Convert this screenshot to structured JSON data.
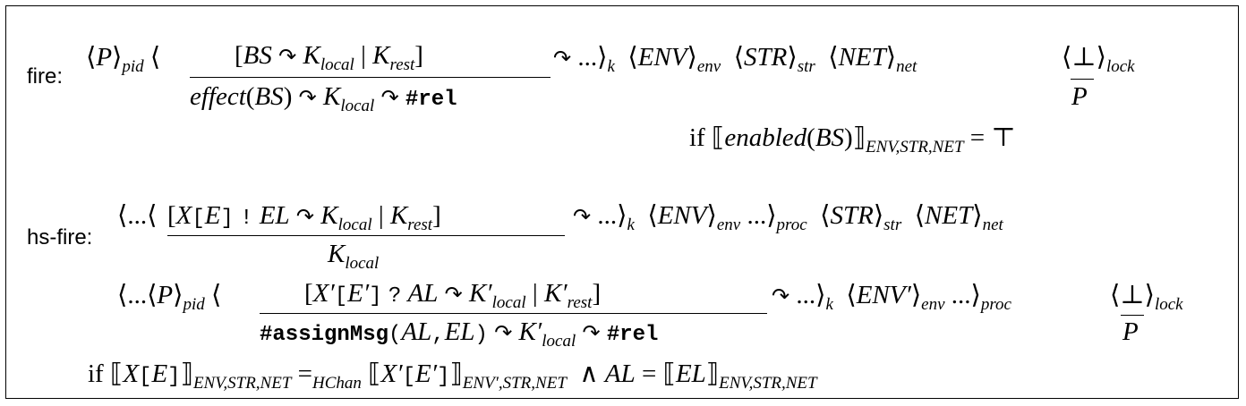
{
  "rules": [
    {
      "label": "fire:",
      "lines": [
        "⟨P⟩pid ⟨ [BS ↷ Klocal | Krest] / effect(BS) ↷ Klocal ↷ #rel ↷ ...⟩k ⟨ENV⟩env ⟨STR⟩str ⟨NET⟩net ⟨⊥ / P⟩lock",
        "if ⟦enabled(BS)⟧ENV,STR,NET = ⊤"
      ]
    },
    {
      "label": "hs-fire:",
      "lines": [
        "⟨...⟨[X[E] ! EL ↷ Klocal | Krest] / Klocal ↷ ...⟩k ⟨ENV⟩env ...⟩proc ⟨STR⟩str ⟨NET⟩net",
        "⟨...⟨P⟩pid ⟨ [X′[E′] ? AL ↷ K′local | K′rest] / #assignMsg(AL,EL) ↷ K′local ↷ #rel ↷ ...⟩k ⟨ENV′⟩env ...⟩proc ⟨⊥ / P⟩lock",
        "if ⟦X[E]⟧ENV,STR,NET =HChan ⟦X′[E′]⟧ENV′,STR,NET ∧ AL = ⟦EL⟧ENV,STR,NET"
      ]
    }
  ],
  "sym": {
    "lang": "⟨",
    "rang": "⟩",
    "lsem": "⟦",
    "rsem": "⟧",
    "arc": "↷",
    "bar": "|",
    "dots": "...",
    "bot": "⊥",
    "top": "⊤",
    "and": "∧",
    "eq": "="
  },
  "v": {
    "P": "P",
    "BS": "BS",
    "Klocal_K": "K",
    "local": "local",
    "rest": "rest",
    "effect": "effect",
    "enabled": "enabled",
    "rel": "#rel",
    "assignMsg": "#assignMsg",
    "ENV": "ENV",
    "ENVp": "ENV′",
    "STR": "STR",
    "NET": "NET",
    "pid": "pid",
    "k": "k",
    "env": "env",
    "str": "str",
    "net": "net",
    "lock": "lock",
    "proc": "proc",
    "if": "if",
    "HChan": "HChan",
    "sub_env_str_net": "ENV,STR,NET",
    "sub_envp_str_net": "ENV′,STR,NET",
    "X": "X",
    "Xp": "X′",
    "E_open": "[",
    "E_close": "]",
    "E": "E",
    "Ep": "E′",
    "bang": "!",
    "ques": "?",
    "EL": "EL",
    "AL": "AL",
    "Kp": "K′"
  }
}
